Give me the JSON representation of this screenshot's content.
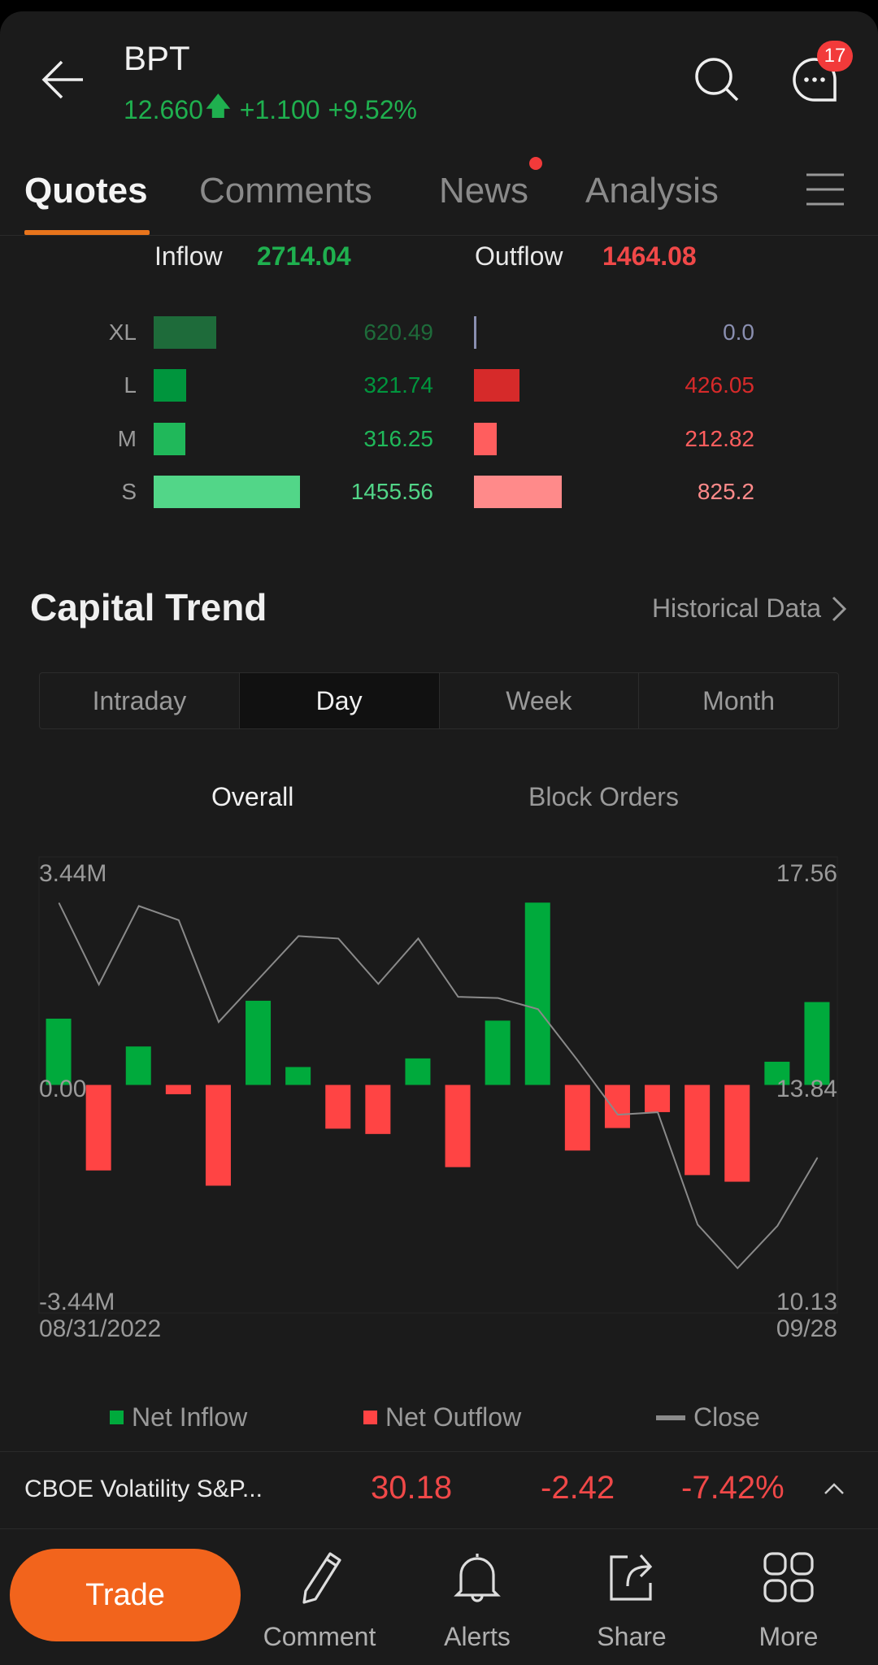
{
  "header": {
    "ticker": "BPT",
    "price": "12.660",
    "change": "+1.100",
    "change_pct": "+9.52%",
    "notifications": "17",
    "price_color": "#1fb04f"
  },
  "tabs": [
    {
      "label": "Quotes",
      "active": true
    },
    {
      "label": "Comments"
    },
    {
      "label": "News",
      "has_dot": true
    },
    {
      "label": "Analysis"
    }
  ],
  "flow": {
    "inflow_label": "Inflow",
    "inflow_total": "2714.04",
    "outflow_label": "Outflow",
    "outflow_total": "1464.08",
    "rows": [
      {
        "size": "XL",
        "inflow": "620.49",
        "outflow": "0.0",
        "inflow_color": "#1e6b3a",
        "outflow_color": "#8a8fb0"
      },
      {
        "size": "L",
        "inflow": "321.74",
        "outflow": "426.05",
        "inflow_color": "#00953d",
        "outflow_color": "#d62a2a"
      },
      {
        "size": "M",
        "inflow": "316.25",
        "outflow": "212.82",
        "inflow_color": "#20b85a",
        "outflow_color": "#ff5e5e"
      },
      {
        "size": "S",
        "inflow": "1455.56",
        "outflow": "825.2",
        "inflow_color": "#52d688",
        "outflow_color": "#ff8a8a"
      }
    ]
  },
  "capital_trend": {
    "title": "Capital Trend",
    "historical_link": "Historical Data",
    "periods": [
      "Intraday",
      "Day",
      "Week",
      "Month"
    ],
    "active_period": "Day",
    "subtabs": [
      "Overall",
      "Block Orders"
    ],
    "active_subtab": "Overall"
  },
  "chart_data": {
    "type": "bar",
    "left_axis": {
      "max": "3.44M",
      "zero": "0.00",
      "min": "-3.44M",
      "ylim": [
        -3.44,
        3.44
      ],
      "unit": "M"
    },
    "right_axis": {
      "max": "17.56",
      "mid": "13.84",
      "min": "10.13",
      "ylim": [
        10.13,
        17.56
      ]
    },
    "x_start": "08/31/2022",
    "x_end": "09/28",
    "net_flow": [
      1.0,
      -1.29,
      0.58,
      -0.14,
      -1.52,
      1.27,
      0.27,
      -0.66,
      -0.74,
      0.4,
      -1.24,
      0.97,
      2.75,
      -0.99,
      -0.65,
      -0.41,
      -1.36,
      -1.46,
      0.35,
      1.25
    ],
    "close": [
      16.81,
      15.48,
      16.76,
      16.53,
      14.87,
      15.57,
      16.27,
      16.23,
      15.49,
      16.23,
      15.28,
      15.26,
      15.08,
      14.24,
      13.36,
      13.4,
      11.57,
      10.86,
      11.55,
      12.66
    ],
    "legend": [
      {
        "name": "Net Inflow",
        "color": "#00aa3c"
      },
      {
        "name": "Net Outflow",
        "color": "#ff4444"
      },
      {
        "name": "Close",
        "color": "#8a8a8a"
      }
    ]
  },
  "ticker_bar": {
    "name": "CBOE Volatility S&P...",
    "price": "30.18",
    "change": "-2.42",
    "change_pct": "-7.42%"
  },
  "bottom_nav": {
    "trade": "Trade",
    "items": [
      "Comment",
      "Alerts",
      "Share",
      "More"
    ]
  }
}
